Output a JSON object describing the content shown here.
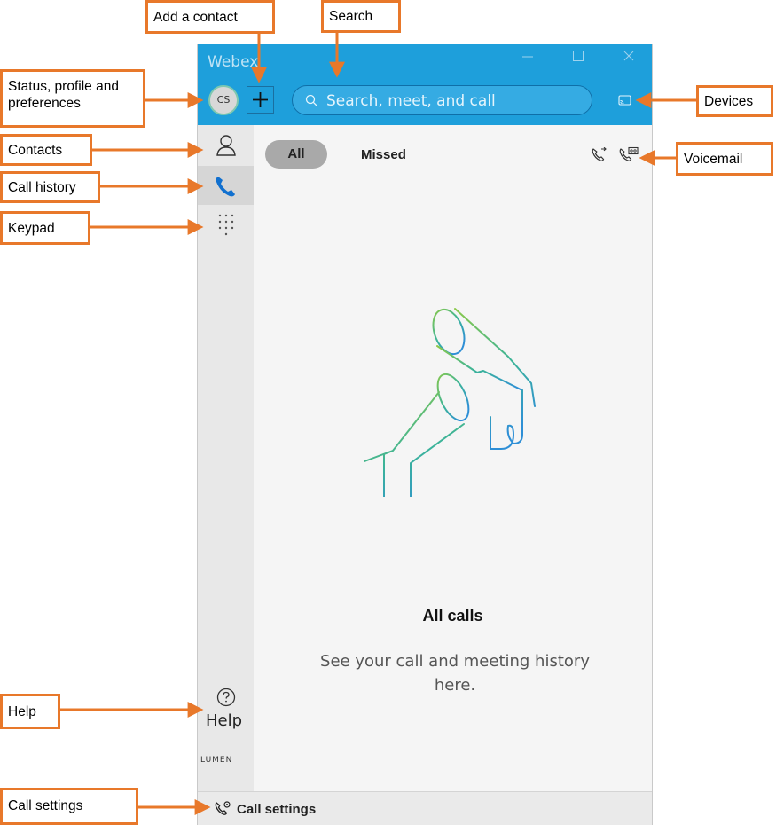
{
  "window": {
    "app_title": "Webex",
    "avatar_initials": "CS",
    "search_placeholder": "Search, meet, and call",
    "tabs": [
      {
        "label": "All",
        "selected": true
      },
      {
        "label": "Missed",
        "selected": false
      }
    ],
    "empty_state": {
      "title": "All calls",
      "description": "See your call and meeting history here."
    },
    "sidebar": {
      "help_label": "Help",
      "brand": "LUMEN"
    },
    "bottom_bar": {
      "call_settings_label": "Call settings"
    },
    "colors": {
      "titlebar": "#1e9fdb",
      "accent_phone": "#1170cf",
      "sidebar": "#e8e8e8",
      "content": "#f5f5f5"
    }
  },
  "callouts": {
    "add_contact": "Add a contact",
    "search": "Search",
    "status_profile": "Status, profile and preferences",
    "devices": "Devices",
    "contacts": "Contacts",
    "voicemail": "Voicemail",
    "call_history": "Call history",
    "keypad": "Keypad",
    "help": "Help",
    "call_settings": "Call settings",
    "border_color": "#e8782a"
  }
}
